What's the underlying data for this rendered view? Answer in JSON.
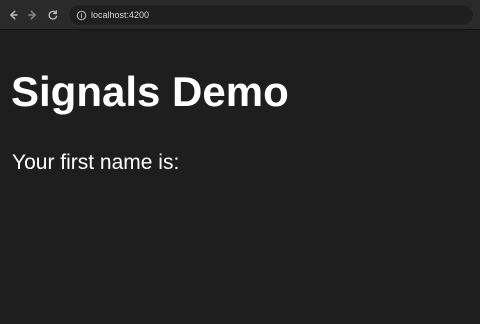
{
  "browser": {
    "url": "localhost:4200",
    "icons": {
      "back": "back-icon",
      "forward": "forward-icon",
      "reload": "reload-icon",
      "site_info": "site-info-icon"
    }
  },
  "page": {
    "title": "Signals Demo",
    "first_name_label": "Your first name is:"
  },
  "colors": {
    "background": "#1e1e1e",
    "chrome": "#2a2a2a",
    "text": "#ffffff"
  }
}
